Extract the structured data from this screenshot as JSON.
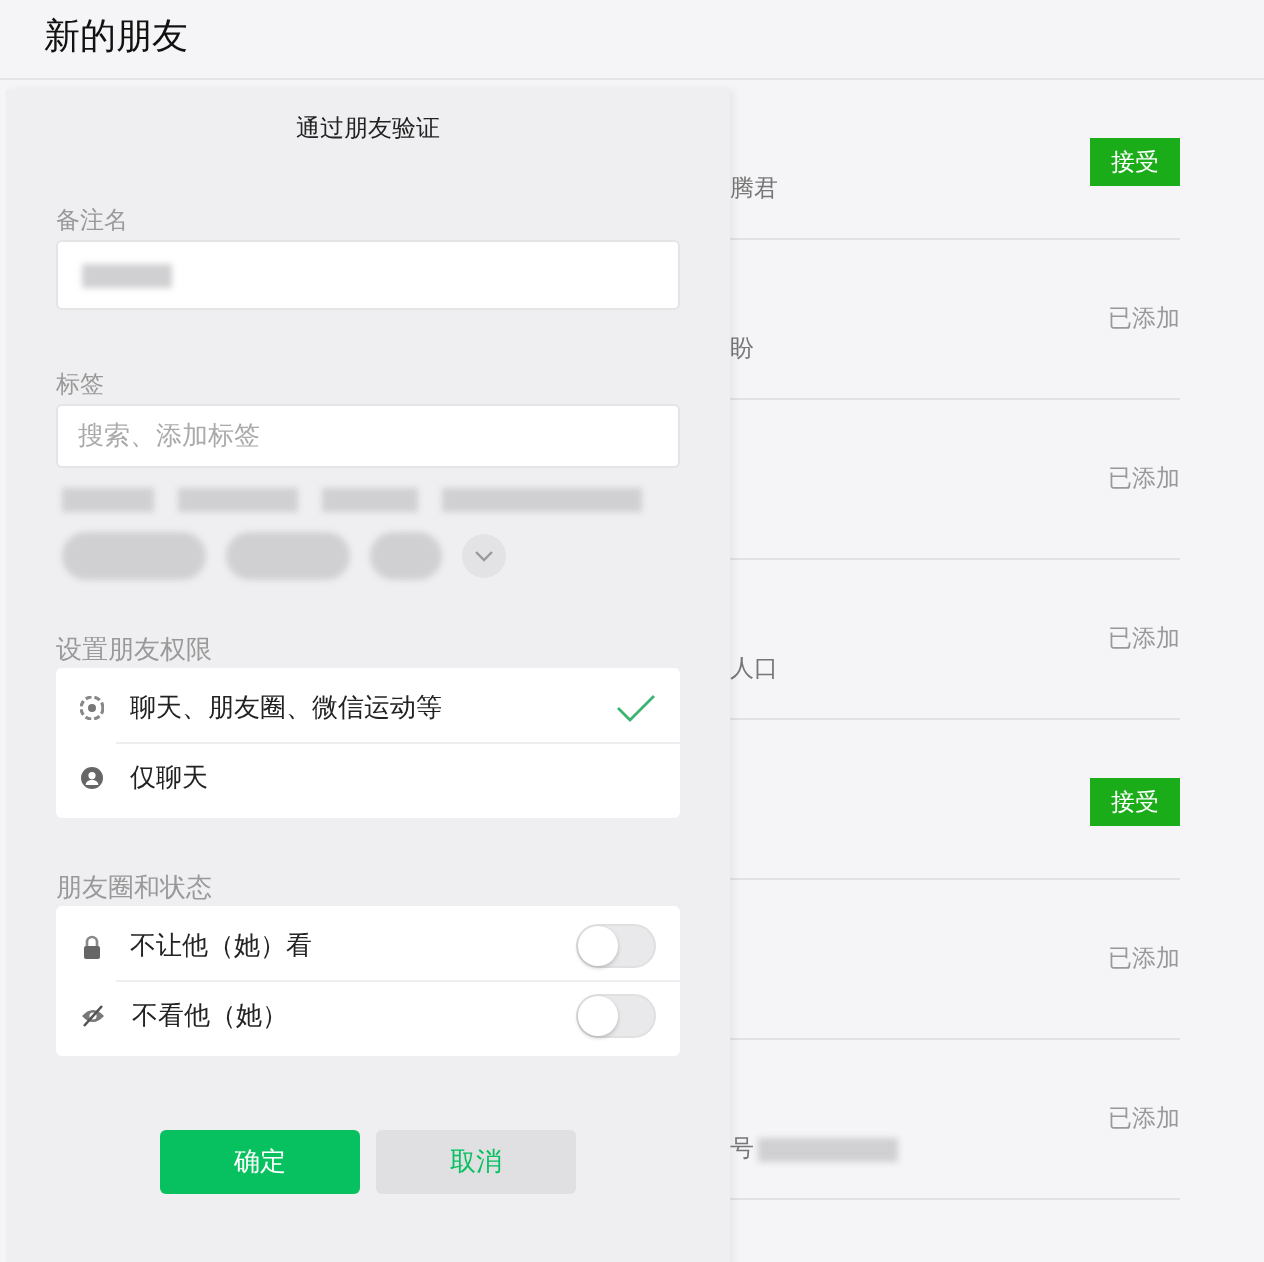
{
  "header": {
    "title": "新的朋友"
  },
  "requests": [
    {
      "subtitle": "腾君",
      "action": {
        "kind": "button",
        "label": "接受"
      }
    },
    {
      "subtitle": "盼",
      "action": {
        "kind": "status",
        "label": "已添加"
      }
    },
    {
      "action": {
        "kind": "status",
        "label": "已添加"
      }
    },
    {
      "subtitle": "人口",
      "action": {
        "kind": "status",
        "label": "已添加"
      }
    },
    {
      "action": {
        "kind": "button",
        "label": "接受"
      }
    },
    {
      "action": {
        "kind": "status",
        "label": "已添加"
      }
    },
    {
      "subtitle": "号",
      "action": {
        "kind": "status",
        "label": "已添加"
      }
    }
  ],
  "dialog": {
    "title": "通过朋友验证",
    "remark": {
      "label": "备注名"
    },
    "tags": {
      "label": "标签",
      "placeholder": "搜索、添加标签"
    },
    "permissions": {
      "label": "设置朋友权限",
      "options": [
        {
          "label": "聊天、朋友圈、微信运动等",
          "selected": true
        },
        {
          "label": "仅聊天",
          "selected": false
        }
      ]
    },
    "moments": {
      "label": "朋友圈和状态",
      "toggles": [
        {
          "label": "不让他（她）看",
          "on": false
        },
        {
          "label": "不看他（她）",
          "on": false
        }
      ]
    },
    "buttons": [
      {
        "kind": "primary",
        "label": "确定"
      },
      {
        "kind": "secondary",
        "label": "取消"
      }
    ]
  }
}
